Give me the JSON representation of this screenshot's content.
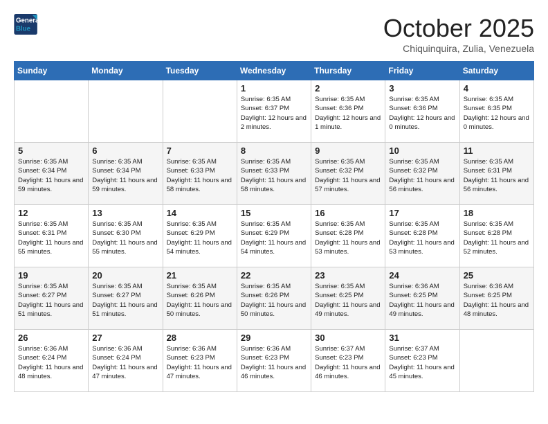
{
  "header": {
    "logo_line1": "General",
    "logo_line2": "Blue",
    "month": "October 2025",
    "location": "Chiquinquira, Zulia, Venezuela"
  },
  "weekdays": [
    "Sunday",
    "Monday",
    "Tuesday",
    "Wednesday",
    "Thursday",
    "Friday",
    "Saturday"
  ],
  "weeks": [
    [
      {
        "day": "",
        "sunrise": "",
        "sunset": "",
        "daylight": ""
      },
      {
        "day": "",
        "sunrise": "",
        "sunset": "",
        "daylight": ""
      },
      {
        "day": "",
        "sunrise": "",
        "sunset": "",
        "daylight": ""
      },
      {
        "day": "1",
        "sunrise": "Sunrise: 6:35 AM",
        "sunset": "Sunset: 6:37 PM",
        "daylight": "Daylight: 12 hours and 2 minutes."
      },
      {
        "day": "2",
        "sunrise": "Sunrise: 6:35 AM",
        "sunset": "Sunset: 6:36 PM",
        "daylight": "Daylight: 12 hours and 1 minute."
      },
      {
        "day": "3",
        "sunrise": "Sunrise: 6:35 AM",
        "sunset": "Sunset: 6:36 PM",
        "daylight": "Daylight: 12 hours and 0 minutes."
      },
      {
        "day": "4",
        "sunrise": "Sunrise: 6:35 AM",
        "sunset": "Sunset: 6:35 PM",
        "daylight": "Daylight: 12 hours and 0 minutes."
      }
    ],
    [
      {
        "day": "5",
        "sunrise": "Sunrise: 6:35 AM",
        "sunset": "Sunset: 6:34 PM",
        "daylight": "Daylight: 11 hours and 59 minutes."
      },
      {
        "day": "6",
        "sunrise": "Sunrise: 6:35 AM",
        "sunset": "Sunset: 6:34 PM",
        "daylight": "Daylight: 11 hours and 59 minutes."
      },
      {
        "day": "7",
        "sunrise": "Sunrise: 6:35 AM",
        "sunset": "Sunset: 6:33 PM",
        "daylight": "Daylight: 11 hours and 58 minutes."
      },
      {
        "day": "8",
        "sunrise": "Sunrise: 6:35 AM",
        "sunset": "Sunset: 6:33 PM",
        "daylight": "Daylight: 11 hours and 58 minutes."
      },
      {
        "day": "9",
        "sunrise": "Sunrise: 6:35 AM",
        "sunset": "Sunset: 6:32 PM",
        "daylight": "Daylight: 11 hours and 57 minutes."
      },
      {
        "day": "10",
        "sunrise": "Sunrise: 6:35 AM",
        "sunset": "Sunset: 6:32 PM",
        "daylight": "Daylight: 11 hours and 56 minutes."
      },
      {
        "day": "11",
        "sunrise": "Sunrise: 6:35 AM",
        "sunset": "Sunset: 6:31 PM",
        "daylight": "Daylight: 11 hours and 56 minutes."
      }
    ],
    [
      {
        "day": "12",
        "sunrise": "Sunrise: 6:35 AM",
        "sunset": "Sunset: 6:31 PM",
        "daylight": "Daylight: 11 hours and 55 minutes."
      },
      {
        "day": "13",
        "sunrise": "Sunrise: 6:35 AM",
        "sunset": "Sunset: 6:30 PM",
        "daylight": "Daylight: 11 hours and 55 minutes."
      },
      {
        "day": "14",
        "sunrise": "Sunrise: 6:35 AM",
        "sunset": "Sunset: 6:29 PM",
        "daylight": "Daylight: 11 hours and 54 minutes."
      },
      {
        "day": "15",
        "sunrise": "Sunrise: 6:35 AM",
        "sunset": "Sunset: 6:29 PM",
        "daylight": "Daylight: 11 hours and 54 minutes."
      },
      {
        "day": "16",
        "sunrise": "Sunrise: 6:35 AM",
        "sunset": "Sunset: 6:28 PM",
        "daylight": "Daylight: 11 hours and 53 minutes."
      },
      {
        "day": "17",
        "sunrise": "Sunrise: 6:35 AM",
        "sunset": "Sunset: 6:28 PM",
        "daylight": "Daylight: 11 hours and 53 minutes."
      },
      {
        "day": "18",
        "sunrise": "Sunrise: 6:35 AM",
        "sunset": "Sunset: 6:28 PM",
        "daylight": "Daylight: 11 hours and 52 minutes."
      }
    ],
    [
      {
        "day": "19",
        "sunrise": "Sunrise: 6:35 AM",
        "sunset": "Sunset: 6:27 PM",
        "daylight": "Daylight: 11 hours and 51 minutes."
      },
      {
        "day": "20",
        "sunrise": "Sunrise: 6:35 AM",
        "sunset": "Sunset: 6:27 PM",
        "daylight": "Daylight: 11 hours and 51 minutes."
      },
      {
        "day": "21",
        "sunrise": "Sunrise: 6:35 AM",
        "sunset": "Sunset: 6:26 PM",
        "daylight": "Daylight: 11 hours and 50 minutes."
      },
      {
        "day": "22",
        "sunrise": "Sunrise: 6:35 AM",
        "sunset": "Sunset: 6:26 PM",
        "daylight": "Daylight: 11 hours and 50 minutes."
      },
      {
        "day": "23",
        "sunrise": "Sunrise: 6:35 AM",
        "sunset": "Sunset: 6:25 PM",
        "daylight": "Daylight: 11 hours and 49 minutes."
      },
      {
        "day": "24",
        "sunrise": "Sunrise: 6:36 AM",
        "sunset": "Sunset: 6:25 PM",
        "daylight": "Daylight: 11 hours and 49 minutes."
      },
      {
        "day": "25",
        "sunrise": "Sunrise: 6:36 AM",
        "sunset": "Sunset: 6:25 PM",
        "daylight": "Daylight: 11 hours and 48 minutes."
      }
    ],
    [
      {
        "day": "26",
        "sunrise": "Sunrise: 6:36 AM",
        "sunset": "Sunset: 6:24 PM",
        "daylight": "Daylight: 11 hours and 48 minutes."
      },
      {
        "day": "27",
        "sunrise": "Sunrise: 6:36 AM",
        "sunset": "Sunset: 6:24 PM",
        "daylight": "Daylight: 11 hours and 47 minutes."
      },
      {
        "day": "28",
        "sunrise": "Sunrise: 6:36 AM",
        "sunset": "Sunset: 6:23 PM",
        "daylight": "Daylight: 11 hours and 47 minutes."
      },
      {
        "day": "29",
        "sunrise": "Sunrise: 6:36 AM",
        "sunset": "Sunset: 6:23 PM",
        "daylight": "Daylight: 11 hours and 46 minutes."
      },
      {
        "day": "30",
        "sunrise": "Sunrise: 6:37 AM",
        "sunset": "Sunset: 6:23 PM",
        "daylight": "Daylight: 11 hours and 46 minutes."
      },
      {
        "day": "31",
        "sunrise": "Sunrise: 6:37 AM",
        "sunset": "Sunset: 6:23 PM",
        "daylight": "Daylight: 11 hours and 45 minutes."
      },
      {
        "day": "",
        "sunrise": "",
        "sunset": "",
        "daylight": ""
      }
    ]
  ]
}
